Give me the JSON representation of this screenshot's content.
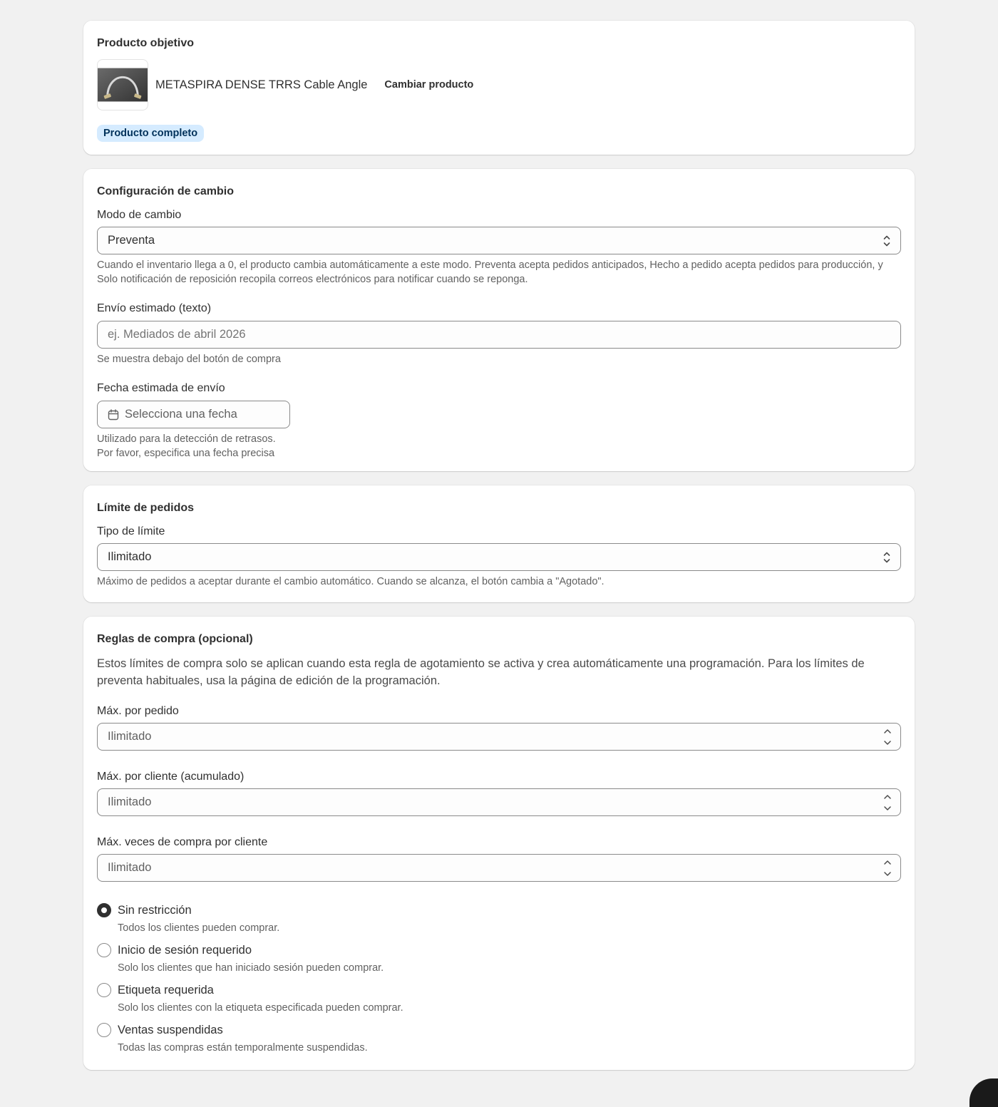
{
  "product_card": {
    "title": "Producto objetivo",
    "product_name": "METASPIRA DENSE TRRS Cable Angle",
    "change_button": "Cambiar producto",
    "badge": "Producto completo",
    "thumbnail_icon": "cable-product-image"
  },
  "switch_config": {
    "title": "Configuración de cambio",
    "mode_label": "Modo de cambio",
    "mode_value": "Preventa",
    "mode_help": "Cuando el inventario llega a 0, el producto cambia automáticamente a este modo. Preventa acepta pedidos anticipados, Hecho a pedido acepta pedidos para producción, y Solo notificación de reposición recopila correos electrónicos para notificar cuando se reponga.",
    "shipping_text_label": "Envío estimado (texto)",
    "shipping_text_placeholder": "ej. Mediados de abril 2026",
    "shipping_text_help": "Se muestra debajo del botón de compra",
    "ship_date_label": "Fecha estimada de envío",
    "ship_date_placeholder": "Selecciona una fecha",
    "ship_date_help_1": "Utilizado para la detección de retrasos.",
    "ship_date_help_2": "Por favor, especifica una fecha precisa"
  },
  "order_limit": {
    "title": "Límite de pedidos",
    "type_label": "Tipo de límite",
    "type_value": "Ilimitado",
    "help": "Máximo de pedidos a aceptar durante el cambio automático. Cuando se alcanza, el botón cambia a \"Agotado\"."
  },
  "purchase_rules": {
    "title": "Reglas de compra (opcional)",
    "description": "Estos límites de compra solo se aplican cuando esta regla de agotamiento se activa y crea automáticamente una programación. Para los límites de preventa habituales, usa la página de edición de la programación.",
    "max_per_order_label": "Máx. por pedido",
    "max_per_order_placeholder": "Ilimitado",
    "max_per_customer_label": "Máx. por cliente (acumulado)",
    "max_per_customer_placeholder": "Ilimitado",
    "max_times_label": "Máx. veces de compra por cliente",
    "max_times_placeholder": "Ilimitado",
    "options": [
      {
        "label": "Sin restricción",
        "help": "Todos los clientes pueden comprar.",
        "selected": true
      },
      {
        "label": "Inicio de sesión requerido",
        "help": "Solo los clientes que han iniciado sesión pueden comprar.",
        "selected": false
      },
      {
        "label": "Etiqueta requerida",
        "help": "Solo los clientes con la etiqueta especificada pueden comprar.",
        "selected": false
      },
      {
        "label": "Ventas suspendidas",
        "help": "Todas las compras están temporalmente suspendidas.",
        "selected": false
      }
    ]
  },
  "colors": {
    "page_bg": "#f1f1f1",
    "card_bg": "#ffffff",
    "badge_bg": "#d5ebff",
    "text": "#303030",
    "subdued": "#616161"
  }
}
